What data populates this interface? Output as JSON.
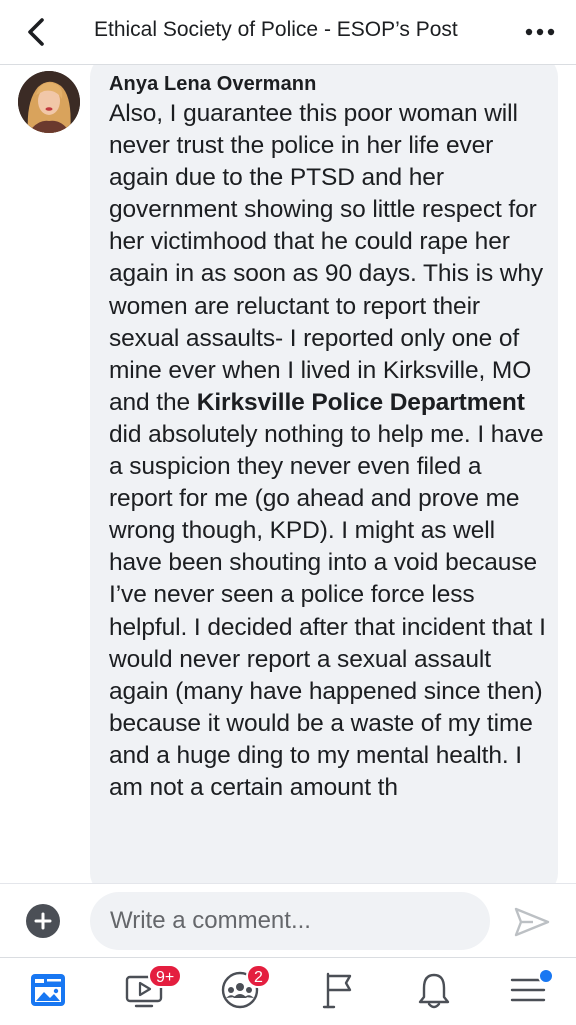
{
  "header": {
    "title": "Ethical Society of Police - ESOP’s Post",
    "back_icon": "chevron-left-icon",
    "more_icon": "more-horizontal-icon"
  },
  "comment": {
    "author": "Anya Lena Overmann",
    "text_before": "Also, I guarantee this poor woman will never trust the police in her life ever again due to the PTSD and her government showing so little respect for her victimhood that he could rape her again in as soon as 90 days. This is why women are reluctant to report their sexual assaults- I reported only one of mine ever when I lived in Kirksville, MO and the ",
    "mention": "Kirksville Police Department",
    "text_after": " did absolutely nothing to help me. I have a suspicion they never even filed a report for me (go ahead and prove me wrong though, KPD). I might as well have been shouting into a void because I’ve never seen a police force less helpful. I decided after that incident that I would never report a sexual assault again (many have happened since then) because it would be a waste of my time and a huge ding to my mental health. I am not a certain amount th"
  },
  "composer": {
    "placeholder": "Write a comment...",
    "value": "",
    "plus_icon": "plus-icon",
    "send_icon": "send-icon"
  },
  "nav": {
    "items": [
      {
        "name": "news-feed",
        "icon": "news-feed-icon",
        "active": true
      },
      {
        "name": "watch",
        "icon": "video-icon",
        "badge": "9+"
      },
      {
        "name": "groups",
        "icon": "groups-icon",
        "badge": "2"
      },
      {
        "name": "pages",
        "icon": "flag-icon"
      },
      {
        "name": "notifications",
        "icon": "bell-icon"
      },
      {
        "name": "menu",
        "icon": "menu-icon"
      }
    ]
  },
  "colors": {
    "accent": "#1877f2",
    "badge": "#e41e3f",
    "bubble": "#f0f2f5"
  }
}
